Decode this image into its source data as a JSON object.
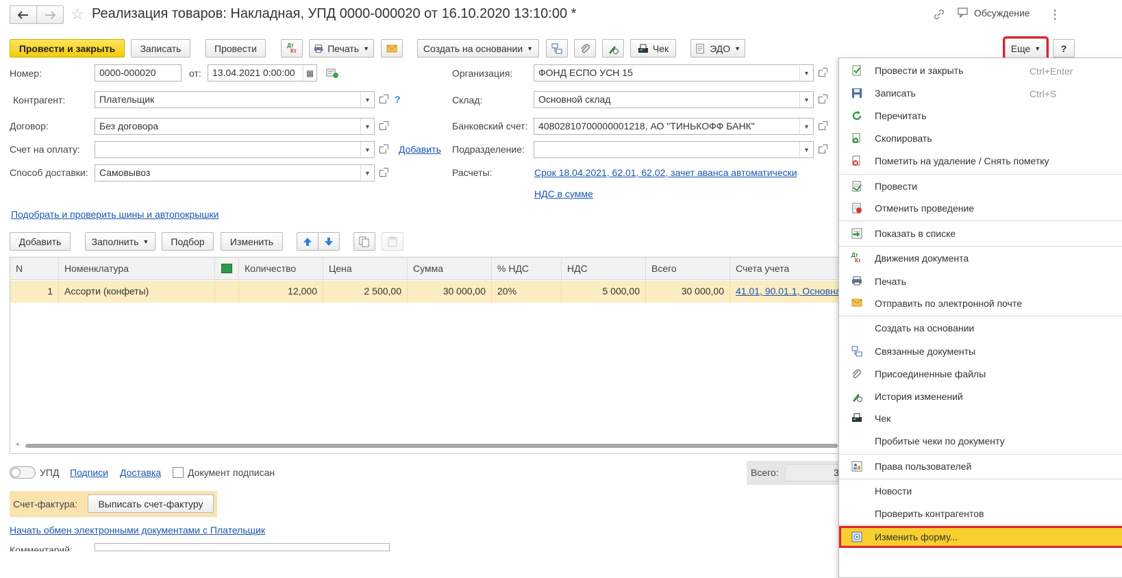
{
  "window": {
    "title": "Реализация товаров: Накладная, УПД 0000-000020 от 16.10.2020 13:10:00 *",
    "discussion": "Обсуждение"
  },
  "toolbar": {
    "post_close": "Провести и закрыть",
    "save": "Записать",
    "post": "Провести",
    "dtkt": "Дт Кт",
    "print": "Печать",
    "create_based": "Создать на основании",
    "receipt": "Чек",
    "edo": "ЭДО",
    "more": "Еще",
    "help": "?"
  },
  "form": {
    "number_label": "Номер:",
    "number_value": "0000-000020",
    "date_label": "от:",
    "date_value": "13.04.2021  0:00:00",
    "counterparty_label": "Контрагент:",
    "counterparty_value": "Плательщик",
    "contract_label": "Договор:",
    "contract_value": "Без договора",
    "invoice_label": "Счет на оплату:",
    "invoice_value": "",
    "add_link": "Добавить",
    "delivery_label": "Способ доставки:",
    "delivery_value": "Самовывоз",
    "org_label": "Организация:",
    "org_value": "ФОНД ЕСПО УСН 15",
    "warehouse_label": "Склад:",
    "warehouse_value": "Основной склад",
    "bank_label": "Банковский счет:",
    "bank_value": "40802810700000001218, АО \"ТИНЬКОФФ БАНК\"",
    "dept_label": "Подразделение:",
    "dept_value": "",
    "settlements_label": "Расчеты:",
    "settlements_link": "Срок 18.04.2021, 62.01, 62.02, зачет аванса автоматически",
    "vat_link": "НДС в сумме",
    "tires_link": "Подобрать и проверить шины и автопокрышки"
  },
  "table_toolbar": {
    "add": "Добавить",
    "fill": "Заполнить",
    "pick": "Подбор",
    "change": "Изменить"
  },
  "table": {
    "headers": [
      "N",
      "Номенклатура",
      "",
      "Количество",
      "Цена",
      "Сумма",
      "% НДС",
      "НДС",
      "Всего",
      "Счета учета"
    ],
    "rows": [
      {
        "n": "1",
        "item": "Ассорти (конфеты)",
        "qty": "12,000",
        "price": "2 500,00",
        "sum": "30 000,00",
        "vat_rate": "20%",
        "vat": "5 000,00",
        "total": "30 000,00",
        "accounts": "41.01, 90.01.1, Основна"
      }
    ]
  },
  "footer": {
    "upd": "УПД",
    "signatures": "Подписи",
    "delivery": "Доставка",
    "signed": "Документ подписан",
    "total_label": "Всего:",
    "total_value": "3",
    "invoice_label": "Счет-фактура:",
    "invoice_button": "Выписать счет-фактуру",
    "edo_link": "Начать обмен электронными документами с Плательщик",
    "comment_label": "Комментарий:"
  },
  "menu": {
    "items": [
      {
        "label": "Провести и закрыть",
        "shortcut": "Ctrl+Enter",
        "icon": "post-close-icon"
      },
      {
        "label": "Записать",
        "shortcut": "Ctrl+S",
        "icon": "save-icon"
      },
      {
        "label": "Перечитать",
        "shortcut": "",
        "icon": "reload-icon"
      },
      {
        "label": "Скопировать",
        "shortcut": "",
        "icon": "copy-icon"
      },
      {
        "label": "Пометить на удаление / Снять пометку",
        "shortcut": "",
        "icon": "delete-mark-icon"
      },
      {
        "label": "Провести",
        "shortcut": "",
        "icon": "post-icon"
      },
      {
        "label": "Отменить проведение",
        "shortcut": "",
        "icon": "unpost-icon"
      },
      {
        "label": "Показать в списке",
        "shortcut": "",
        "icon": "show-in-list-icon"
      },
      {
        "label": "Движения документа",
        "shortcut": "",
        "icon": "dtkt-icon"
      },
      {
        "label": "Печать",
        "shortcut": "",
        "icon": "printer-icon"
      },
      {
        "label": "Отправить по электронной почте",
        "shortcut": "",
        "icon": "envelope-icon"
      },
      {
        "label": "Создать на основании",
        "shortcut": "",
        "icon": ""
      },
      {
        "label": "Связанные документы",
        "shortcut": "",
        "icon": "linked-docs-icon"
      },
      {
        "label": "Присоединенные файлы",
        "shortcut": "",
        "icon": "paperclip-icon"
      },
      {
        "label": "История изменений",
        "shortcut": "",
        "icon": "history-icon"
      },
      {
        "label": "Чек",
        "shortcut": "",
        "icon": "receipt-icon"
      },
      {
        "label": "Пробитые чеки по документу",
        "shortcut": "",
        "icon": ""
      },
      {
        "label": "Права пользователей",
        "shortcut": "",
        "icon": "user-rights-icon"
      },
      {
        "label": "Новости",
        "shortcut": "",
        "icon": ""
      },
      {
        "label": "Проверить контрагентов",
        "shortcut": "",
        "icon": ""
      },
      {
        "label": "Изменить форму...",
        "shortcut": "",
        "icon": "change-form-icon"
      }
    ]
  },
  "colors": {
    "accent_yellow": "#f7cf2e",
    "highlight_red": "#e3202a",
    "link_blue": "#1a56b0",
    "row_selected": "#fbecc1"
  }
}
